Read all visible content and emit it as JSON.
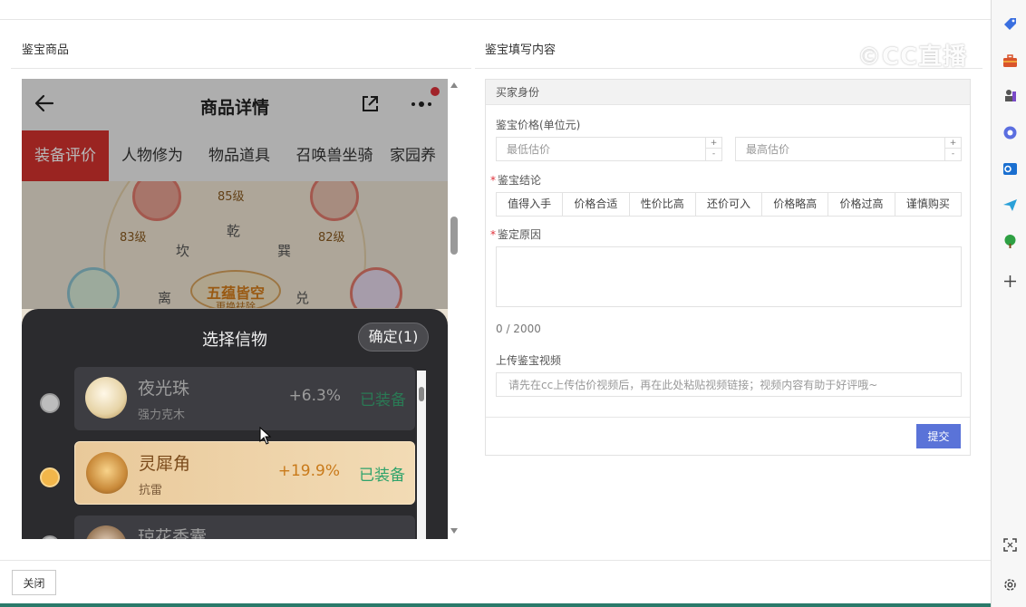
{
  "left_section": {
    "title": "鉴宝商品"
  },
  "right_section": {
    "title": "鉴宝填写内容"
  },
  "watermark": {
    "text": "©CC直播"
  },
  "phone": {
    "header_title": "商品详情",
    "tabs": [
      "装备评价",
      "人物修为",
      "物品道具",
      "召唤兽坐骑",
      "家园养"
    ],
    "art": {
      "levels": [
        "85级",
        "83级",
        "82级"
      ],
      "trigrams": [
        "乾",
        "巽",
        "坎",
        "离",
        "兑"
      ],
      "center_text": "五蕴皆空",
      "center_sub": "更换祛除"
    },
    "sheet": {
      "title": "选择信物",
      "confirm_label": "确定(1)",
      "items": [
        {
          "name": "夜光珠",
          "sub": "强力克木",
          "pct": "+6.3%",
          "tag": "已装备"
        },
        {
          "name": "灵犀角",
          "sub": "抗雷",
          "pct": "+19.9%",
          "tag": "已装备"
        },
        {
          "name": "琼花香囊",
          "sub": "",
          "pct": "",
          "tag": ""
        }
      ]
    }
  },
  "form": {
    "section_header": "买家身份",
    "price_label": "鉴宝价格(单位元)",
    "min_placeholder": "最低估价",
    "max_placeholder": "最高估价",
    "conclusion_label": "鉴宝结论",
    "conclusions": [
      "值得入手",
      "价格合适",
      "性价比高",
      "还价可入",
      "价格略高",
      "价格过高",
      "谨慎购买"
    ],
    "reason_label": "鉴定原因",
    "counter": "0 / 2000",
    "video_label": "上传鉴宝视频",
    "video_placeholder": "请先在cc上传估价视频后，再在此处粘贴视频链接；视频内容有助于好评哦~",
    "submit_label": "提交",
    "required_mark": "*"
  },
  "footer": {
    "close_label": "关闭"
  },
  "colors": {
    "accent": "#5a73d8",
    "tab_active": "#d6322f",
    "equipped": "#2fa36b",
    "required": "#e0313a"
  }
}
